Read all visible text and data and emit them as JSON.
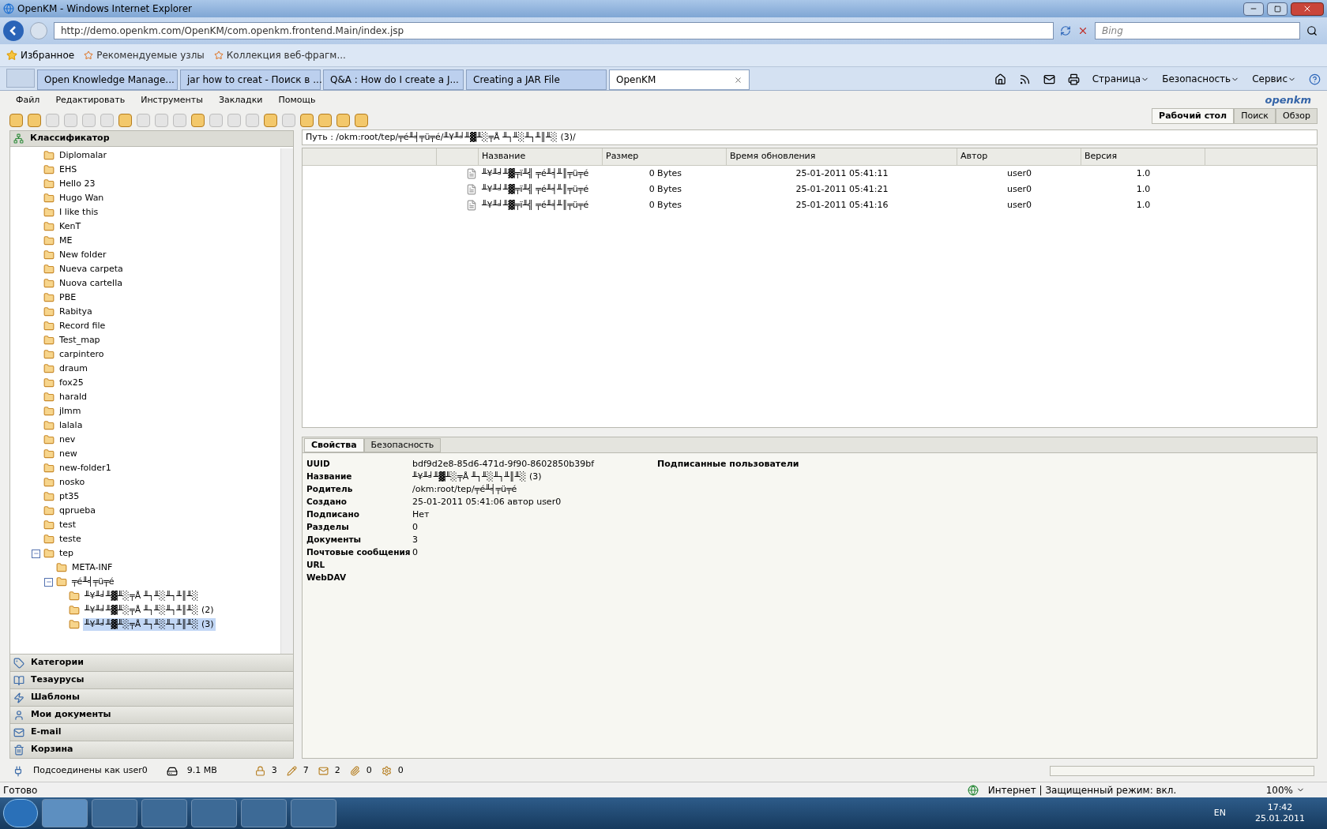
{
  "window": {
    "title": "OpenKM - Windows Internet Explorer"
  },
  "address_bar": {
    "url": "http://demo.openkm.com/OpenKM/com.openkm.frontend.Main/index.jsp",
    "search_placeholder": "Bing"
  },
  "favorites_bar": {
    "favorites": "Избранное",
    "links": [
      "Рекомендуемые узлы",
      "Коллекция веб-фрагм..."
    ]
  },
  "browser_tabs": [
    {
      "label": "Open Knowledge Manage...",
      "selected": false
    },
    {
      "label": "jar how to creat - Поиск в ...",
      "selected": false
    },
    {
      "label": "Q&A : How do I create a J...",
      "selected": false
    },
    {
      "label": "Creating a JAR File",
      "selected": false
    },
    {
      "label": "OpenKM",
      "selected": true
    }
  ],
  "command_bar": [
    "Страница",
    "Безопасность",
    "Сервис"
  ],
  "app_menu": [
    "Файл",
    "Редактировать",
    "Инструменты",
    "Закладки",
    "Помощь"
  ],
  "logo": "openkm",
  "view_tabs": [
    {
      "label": "Рабочий стол",
      "selected": true
    },
    {
      "label": "Поиск",
      "selected": false
    },
    {
      "label": "Обзор",
      "selected": false
    }
  ],
  "navigator": {
    "title": "Классификатор",
    "tree": [
      {
        "label": "Diplomalar"
      },
      {
        "label": "EHS"
      },
      {
        "label": "Hello 23"
      },
      {
        "label": "Hugo Wan"
      },
      {
        "label": "I like this"
      },
      {
        "label": "KenT"
      },
      {
        "label": "ME"
      },
      {
        "label": "New folder"
      },
      {
        "label": "Nueva carpeta"
      },
      {
        "label": "Nuova cartella"
      },
      {
        "label": "PBE"
      },
      {
        "label": "Rabitya"
      },
      {
        "label": "Record file"
      },
      {
        "label": "Test_map"
      },
      {
        "label": "carpintero"
      },
      {
        "label": "draum"
      },
      {
        "label": "fox25"
      },
      {
        "label": "harald"
      },
      {
        "label": "jlmm"
      },
      {
        "label": "lalala"
      },
      {
        "label": "nev"
      },
      {
        "label": "new"
      },
      {
        "label": "new-folder1"
      },
      {
        "label": "nosko"
      },
      {
        "label": "pt35"
      },
      {
        "label": "qprueba"
      },
      {
        "label": "test"
      },
      {
        "label": "teste"
      },
      {
        "label": "tep",
        "expanded": true,
        "children": [
          {
            "label": "META-INF"
          },
          {
            "label": "╤é╨╡╤ü╤é",
            "expanded": true,
            "children": [
              {
                "label": "╨¥╨╛╨▓╨░╤Å ╨┐╨░╨┐╨║╨░",
                "selected": false
              },
              {
                "label": "╨¥╨╛╨▓╨░╤Å ╨┐╨░╨┐╨║╨░ (2)",
                "selected": false
              },
              {
                "label": "╨¥╨╛╨▓╨░╤Å ╨┐╨░╨┐╨║╨░ (3)",
                "selected": true
              }
            ]
          }
        ]
      }
    ]
  },
  "stack_sections": [
    "Категории",
    "Тезаурусы",
    "Шаблоны",
    "Мои документы",
    "E-mail",
    "Корзина"
  ],
  "path": "Путь : /okm:root/tep/╤é╨╡╤ü╤é/╨¥╨╛╨▓╨░╤Å ╨┐╨░╨┐╨║╨░ (3)/",
  "table": {
    "columns": [
      "Название",
      "Размер",
      "Время обновления",
      "Автор",
      "Версия"
    ],
    "rows": [
      [
        "╨¥╨╛╨▓╤ï╨╣ ╤é╨╡╨║╤ü╤é",
        "0 Bytes",
        "25-01-2011 05:41:11",
        "user0",
        "1.0"
      ],
      [
        "╨¥╨╛╨▓╤ï╨╣ ╤é╨╡╨║╤ü╤é",
        "0 Bytes",
        "25-01-2011 05:41:21",
        "user0",
        "1.0"
      ],
      [
        "╨¥╨╛╨▓╤ï╨╣ ╤é╨╡╨║╤ü╤é",
        "0 Bytes",
        "25-01-2011 05:41:16",
        "user0",
        "1.0"
      ]
    ]
  },
  "detail_tabs": [
    {
      "label": "Свойства",
      "selected": true
    },
    {
      "label": "Безопасность",
      "selected": false
    }
  ],
  "properties": [
    {
      "label": "UUID",
      "value": "bdf9d2e8-85d6-471d-9f90-8602850b39bf"
    },
    {
      "label": "Название",
      "value": "╨¥╨╛╨▓╨░╤Å ╨┐╨░╨┐╨║╨░ (3)"
    },
    {
      "label": "Родитель",
      "value": "/okm:root/tep/╤é╨╡╤ü╤é"
    },
    {
      "label": "Создано",
      "value": "25-01-2011 05:41:06 автор user0"
    },
    {
      "label": "Подписано",
      "value": "Нет"
    },
    {
      "label": "Разделы",
      "value": "0"
    },
    {
      "label": "Документы",
      "value": "3"
    },
    {
      "label": "Почтовые сообщения",
      "value": "0"
    },
    {
      "label": "URL"
    },
    {
      "label": "WebDAV"
    }
  ],
  "subscribers_title": "Подписанные пользователи",
  "app_status": {
    "user": "Подсоединены как user0",
    "size": "9.1 MB",
    "counters": [
      "3",
      "7",
      "2",
      "0",
      "0"
    ]
  },
  "ie_status": {
    "text": "Готово",
    "zone": "Интернет | Защищенный режим: вкл.",
    "zoom": "100%"
  },
  "taskbar": {
    "lang": "EN",
    "time": "17:42",
    "date": "25.01.2011"
  }
}
